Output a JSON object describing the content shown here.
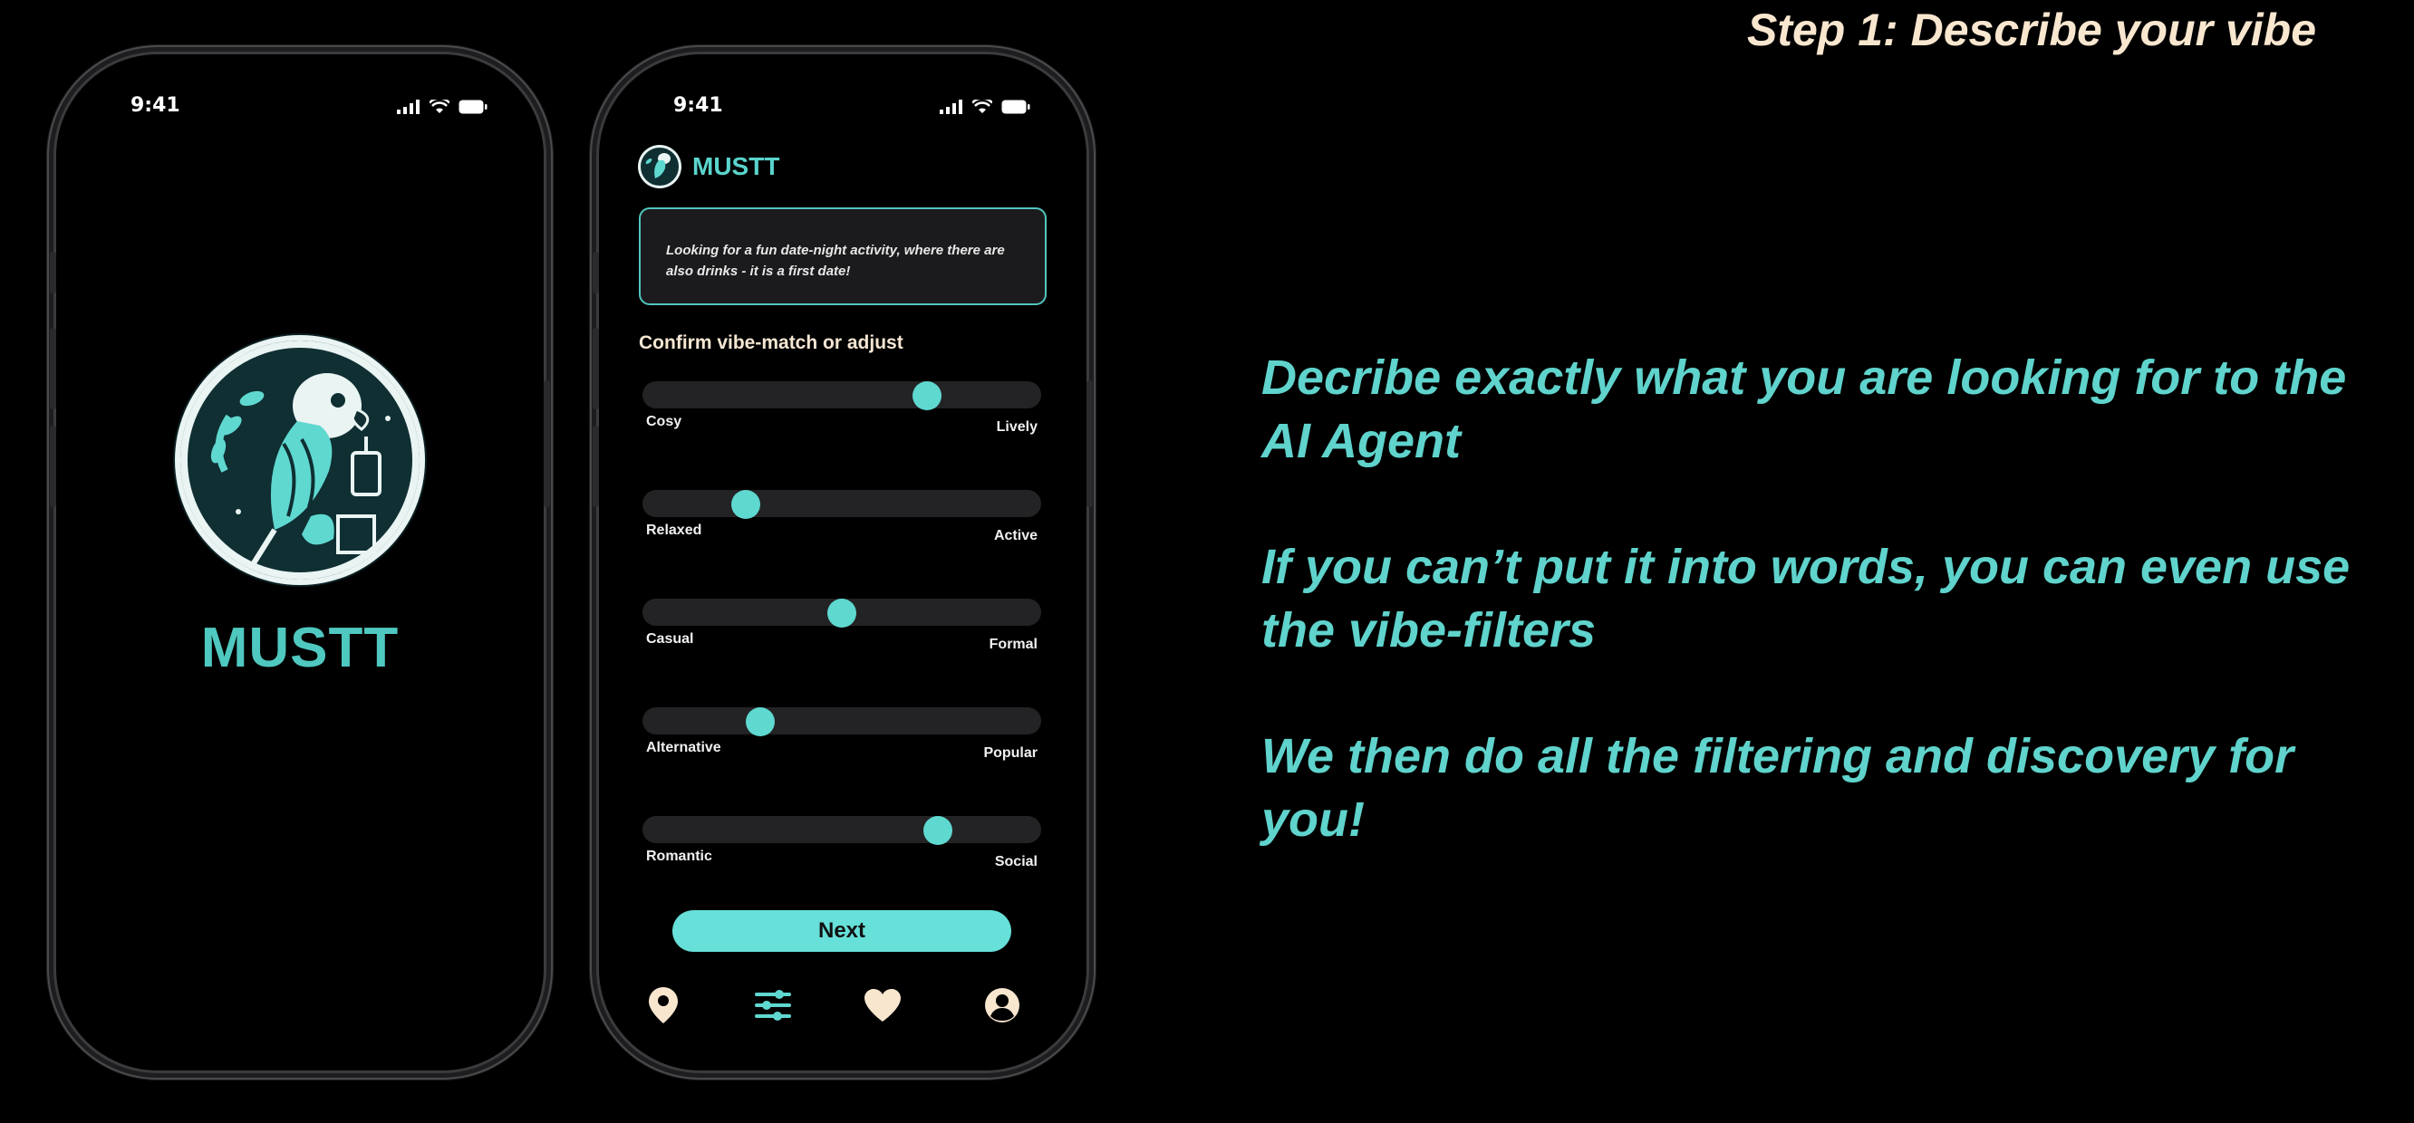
{
  "headline": "Step 1: Describe your vibe",
  "copy": {
    "p1": "Decribe exactly what you are looking for to the AI Agent",
    "p2": "If you can’t put it into words, you can even use the vibe-filters",
    "p3": "We then do all the filtering and discovery for you!"
  },
  "phone_left": {
    "time": "9:41",
    "app_name": "MUSTT"
  },
  "phone_right": {
    "time": "9:41",
    "app_name": "MUSTT",
    "query_text": "Looking for a fun date-night activity, where there are also drinks - it is a first date!",
    "section_title": "Confirm vibe-match or adjust",
    "sliders": [
      {
        "left": "Cosy",
        "right": "Lively",
        "value": 0.73
      },
      {
        "left": "Relaxed",
        "right": "Active",
        "value": 0.24
      },
      {
        "left": "Casual",
        "right": "Formal",
        "value": 0.5
      },
      {
        "left": "Alternative",
        "right": "Popular",
        "value": 0.28
      },
      {
        "left": "Romantic",
        "right": "Social",
        "value": 0.76
      }
    ],
    "next_label": "Next",
    "tabs": [
      "location-pin-icon",
      "filters-icon",
      "heart-icon",
      "profile-icon"
    ]
  },
  "colors": {
    "accent": "#5fd8d0",
    "headline": "#f9e6cf",
    "background": "#000000"
  }
}
